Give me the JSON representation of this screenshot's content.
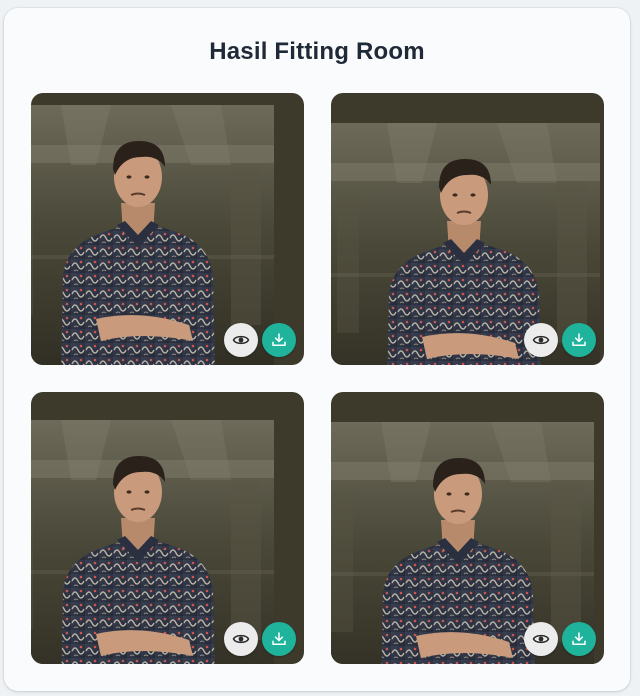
{
  "page": {
    "title": "Hasil Fitting Room"
  },
  "colors": {
    "accent": "#1fb39c",
    "view_button_bg": "#ececec",
    "title_text": "#1f2937"
  },
  "results": [
    {
      "image": "man-in-batik-shirt-arms-crossed",
      "view_icon": "eye-icon",
      "download_icon": "download-icon"
    },
    {
      "image": "man-in-batik-shirt-arms-crossed",
      "view_icon": "eye-icon",
      "download_icon": "download-icon"
    },
    {
      "image": "man-in-batik-shirt-arms-crossed",
      "view_icon": "eye-icon",
      "download_icon": "download-icon"
    },
    {
      "image": "man-in-batik-shirt-arms-crossed",
      "view_icon": "eye-icon",
      "download_icon": "download-icon"
    }
  ]
}
